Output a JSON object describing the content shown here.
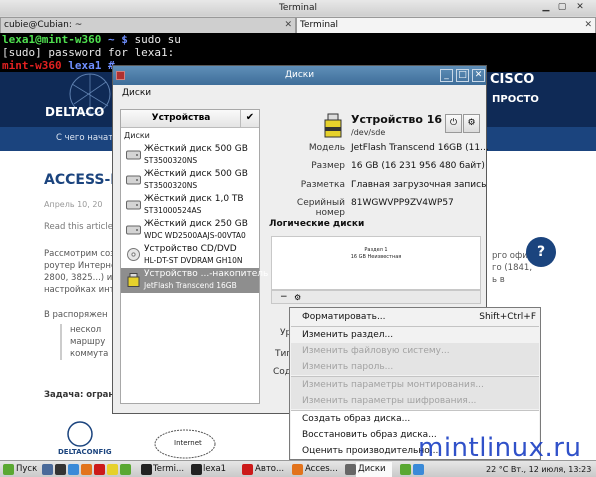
{
  "terminal": {
    "title": "Terminal",
    "tabs": [
      {
        "label": "cubie@Cubian: ~"
      },
      {
        "label": "Terminal"
      }
    ],
    "lines": [
      {
        "user": "lexa1@mint-w360",
        "path": "~",
        "cmd": "sudo su"
      },
      {
        "text": "[sudo] password for lexa1:"
      },
      {
        "user": "mint-w360",
        "path": "lexa1",
        "prompt": "#"
      }
    ]
  },
  "web": {
    "brand_right": "CISCO",
    "brand_right2": "ПРОСТО",
    "brand_left": "DELTACO",
    "nav_item": "С чего начать",
    "article_title": "ACCESS-L",
    "date": "Апрель 10, 20",
    "read_more": "Read this article",
    "body_left": [
      "Рассмотрим созд",
      "роутер Интернет с",
      "2800, 3825...) и мы",
      "настройках инте"
    ],
    "body_right": [
      "рго офиса",
      "го (1841,",
      "ь в"
    ],
    "subhead": "В распоряжен",
    "bullets": [
      "нескол",
      "маршру",
      "коммута"
    ],
    "task": "Задача: ограни",
    "diagram_label": "Internet",
    "logo_text": "DELTACONFIG"
  },
  "disks": {
    "window_title": "Диски",
    "menu_label": "Диски",
    "pane_title": "Устройства",
    "section_label": "Диски",
    "drives": [
      {
        "name": "Жёсткий диск 500 GB",
        "model": "ST3500320NS",
        "icon": "hdd-icon"
      },
      {
        "name": "Жёсткий диск 500 GB",
        "model": "ST3500320NS",
        "icon": "hdd-icon"
      },
      {
        "name": "Жёсткий диск 1,0 TB",
        "model": "ST31000524AS",
        "icon": "hdd-icon"
      },
      {
        "name": "Жёсткий диск 250 GB",
        "model": "WDC WD2500AAJS-00VTA0",
        "icon": "hdd-icon"
      },
      {
        "name": "Устройство CD/DVD",
        "model": "HL-DT-ST DVDRAM GH10N",
        "icon": "optical-disc-icon"
      },
      {
        "name": "Устройство ...-накопитель",
        "model": "JetFlash Transcend 16GB",
        "icon": "usb-drive-icon",
        "selected": true
      }
    ],
    "device": {
      "title": "Устройство 16 ...",
      "path": "/dev/sde",
      "props": [
        {
          "label": "Модель",
          "value": "JetFlash Transcend 16GB (11..."
        },
        {
          "label": "Размер",
          "value": "16 GB (16 231 956 480 байт)"
        },
        {
          "label": "Разметка",
          "value": "Главная загрузочная запись"
        },
        {
          "label": "Серийный номер",
          "value": "81WGWVPP9ZV4WP57"
        }
      ],
      "logical_title": "Логические диски",
      "partition_line1": "Раздел 1",
      "partition_line2": "16 GB Неизвестная",
      "btn_minus": "−",
      "partial_labels": [
        "Ур",
        "Тип",
        "Сод"
      ]
    }
  },
  "context_menu": {
    "items": [
      {
        "label": "Форматировать...",
        "shortcut": "Shift+Ctrl+F",
        "enabled": true
      },
      {
        "label": "Изменить раздел...",
        "enabled": true
      },
      {
        "label": "Изменить файловую систему...",
        "enabled": false
      },
      {
        "label": "Изменить пароль...",
        "enabled": false
      },
      {
        "label": "Изменить параметры монтирования...",
        "enabled": false
      },
      {
        "label": "Изменить параметры шифрования...",
        "enabled": false
      },
      {
        "label": "Создать образ диска...",
        "enabled": true
      },
      {
        "label": "Восстановить образ диска...",
        "enabled": true
      },
      {
        "label": "Оценить производительно...",
        "enabled": true
      }
    ]
  },
  "watermark": "mintlinux.ru",
  "taskbar": {
    "start_label": "Пуск",
    "tasks": [
      "Termi...",
      "lexa1",
      "Авто...",
      "Acces...",
      "Диски"
    ],
    "clock": "22 °C  Вт., 12 июля, 13:23"
  },
  "colors": {
    "titlebar": "#4a7aa6",
    "menu_bg": "#f2f2f2",
    "selected_row": "#8e8e8e",
    "watermark": "#1a3fc4"
  }
}
